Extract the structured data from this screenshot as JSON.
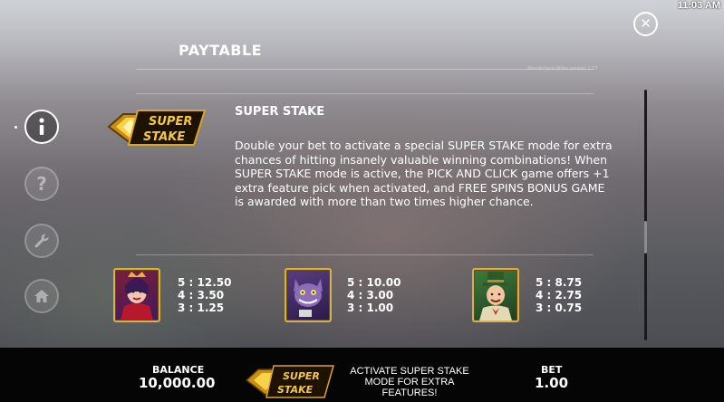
{
  "status_bar": {
    "time": "11:03 AM"
  },
  "header": {
    "title": "PAYTABLE",
    "version": "Wonderland Wilds version 1.17"
  },
  "sidebar": {
    "items": [
      {
        "icon": "info-icon",
        "state": "active"
      },
      {
        "icon": "question-icon",
        "state": "inactive"
      },
      {
        "icon": "wrench-icon",
        "state": "inactive"
      },
      {
        "icon": "home-icon",
        "state": "inactive"
      }
    ]
  },
  "feature": {
    "logo_text": "SUPER STAKE",
    "title": "SUPER STAKE",
    "description": "Double your bet to activate a special SUPER STAKE mode for extra chances of hitting insanely  valuable winning combinations! When SUPER STAKE mode is active, the PICK AND CLICK game offers +1 extra feature pick when activated, and FREE SPINS BONUS GAME is awarded with more than two times higher chance."
  },
  "symbols": [
    {
      "name": "queen-symbol",
      "pays": [
        {
          "count": "5",
          "value": "12.50"
        },
        {
          "count": "4",
          "value": "3.50"
        },
        {
          "count": "3",
          "value": "1.25"
        }
      ]
    },
    {
      "name": "cat-symbol",
      "pays": [
        {
          "count": "5",
          "value": "10.00"
        },
        {
          "count": "4",
          "value": "3.00"
        },
        {
          "count": "3",
          "value": "1.00"
        }
      ]
    },
    {
      "name": "hatter-symbol",
      "pays": [
        {
          "count": "5",
          "value": "8.75"
        },
        {
          "count": "4",
          "value": "2.75"
        },
        {
          "count": "3",
          "value": "0.75"
        }
      ]
    }
  ],
  "bottom_bar": {
    "balance_label": "BALANCE",
    "balance_value": "10,000.00",
    "super_stake_logo": "SUPER STAKE",
    "activate_lines": [
      "ACTIVATE SUPER STAKE",
      "MODE FOR EXTRA",
      "FEATURES!"
    ],
    "bet_label": "BET",
    "bet_value": "1.00"
  },
  "colors": {
    "gold": "#e5b52b",
    "dark_gold": "#6a4c0f",
    "bar_bg": "#050505"
  }
}
